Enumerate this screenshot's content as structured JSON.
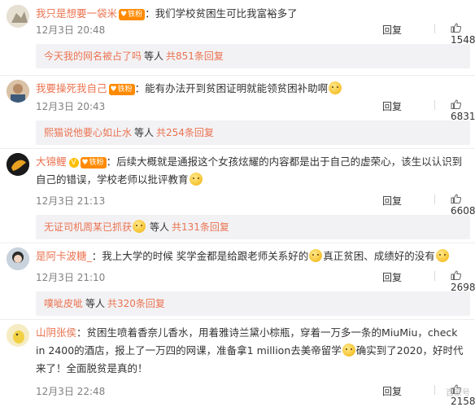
{
  "comments": [
    {
      "username": "我只是想要一袋米",
      "badge": "铁粉",
      "separator": "：",
      "text": "我们学校贫困生可比我富裕多了",
      "time": "12月3日 20:48",
      "reply_label": "回复",
      "likes": "15483",
      "sub_link": "今天我的网名被占了吗",
      "sub_mid": "等人",
      "sub_count": "共851条回复"
    },
    {
      "username": "我要操死我自己",
      "badge": "铁粉",
      "separator": "：",
      "text": "能有办法开到贫困证明就能领贫困补助啊",
      "time": "12月3日 20:43",
      "reply_label": "回复",
      "likes": "6831",
      "sub_link": "熙猫说他要心如止水",
      "sub_mid": "等人",
      "sub_count": "共254条回复"
    },
    {
      "username": "大锦鲤",
      "badge": "铁粉",
      "separator": "：",
      "text": "后续大概就是通报这个女孩炫耀的内容都是出于自己的虚荣心，该生以认识到自己的错误，学校老师以批评教育",
      "time": "12月3日 21:13",
      "reply_label": "回复",
      "likes": "6608",
      "sub_link": "无证司机周某已抓获",
      "sub_mid": "等人",
      "sub_count": "共131条回复"
    },
    {
      "username": "是阿卡波糖_",
      "separator": "：",
      "text_a": "我上大学的时候 奖学金都是给跟老师关系好的",
      "text_b": "真正贫困、成绩好的没有",
      "time": "12月3日 21:10",
      "reply_label": "回复",
      "likes": "2698",
      "sub_link": "噗呲皮呲",
      "sub_mid": "等人",
      "sub_count": "共320条回复"
    },
    {
      "username": "山阴张侯",
      "separator": "：",
      "text_a": "贫困生喷着香奈儿香水，用着雅诗兰黛小棕瓶，穿着一万多一条的MiuMiu，check in 2400的酒店，报上了一万四的网课，准备拿1 million去美帝留学",
      "text_b": "确实到了2020，好时代来了！全面脱贫是真的！",
      "time": "12月3日 22:48",
      "reply_label": "回复",
      "likes": "2158"
    }
  ],
  "watermark": "百家号",
  "colors": {
    "accent": "#eb7350",
    "badge": "#ff8a00",
    "subbg": "#f2f2f5"
  }
}
